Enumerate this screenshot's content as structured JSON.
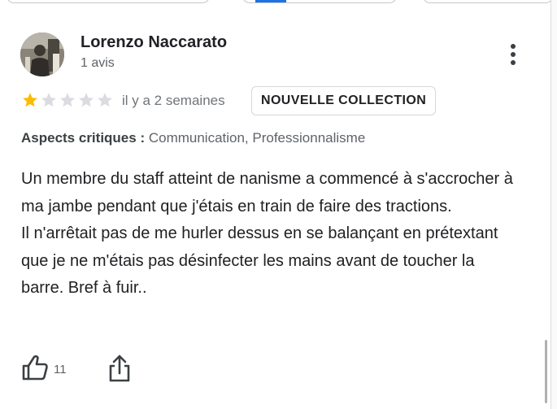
{
  "reviewer": {
    "name": "Lorenzo Naccarato",
    "review_count": "1 avis"
  },
  "rating": {
    "stars_filled": 1,
    "stars_total": 5,
    "star_color_filled": "#fbbc04",
    "star_color_empty": "#dadce0",
    "time": "il y a 2 semaines",
    "badge": "NOUVELLE COLLECTION"
  },
  "aspects": {
    "label": "Aspects critiques :",
    "values": " Communication, Professionnalisme"
  },
  "review": {
    "paragraphs": [
      "Un membre du staff atteint de nanisme a commencé à s'accrocher à ma jambe pendant que j'étais en train de faire des tractions.",
      "Il n'arrêtait pas de me hurler dessus en se balançant en prétextant que je ne m'étais pas désinfecter les mains avant de toucher la barre. Bref à fuir.."
    ]
  },
  "actions": {
    "like_count": "11",
    "like_icon": "thumbs-up-icon",
    "share_icon": "share-icon",
    "menu_icon": "more-vert-icon"
  },
  "colors": {
    "text_primary": "#202124",
    "text_secondary": "#5f6368",
    "accent": "#1a73e8"
  }
}
